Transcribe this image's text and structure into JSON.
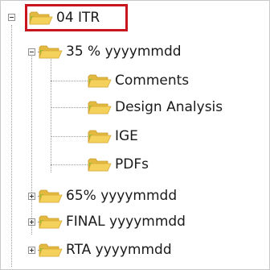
{
  "tree": {
    "root": {
      "label": "04 ITR",
      "icon": "open-folder-icon",
      "expanded": true
    },
    "children": [
      {
        "label": "35 % yyyymmdd",
        "icon": "open-folder-icon",
        "expanded": true,
        "children": [
          {
            "label": "Comments",
            "icon": "folder-icon"
          },
          {
            "label": "Design Analysis",
            "icon": "folder-icon"
          },
          {
            "label": "IGE",
            "icon": "folder-icon"
          },
          {
            "label": "PDFs",
            "icon": "folder-icon"
          }
        ]
      },
      {
        "label": "65% yyyymmdd",
        "icon": "folder-icon",
        "expanded": false
      },
      {
        "label": "FINAL yyyymmdd",
        "icon": "folder-icon",
        "expanded": false
      },
      {
        "label": "RTA yyyymmdd",
        "icon": "folder-icon",
        "expanded": false
      }
    ]
  },
  "colors": {
    "highlight": "#c9151e",
    "folder_fill": "#f4d15b",
    "folder_back": "#e3b93f",
    "folder_accent": "#8fc43a"
  }
}
